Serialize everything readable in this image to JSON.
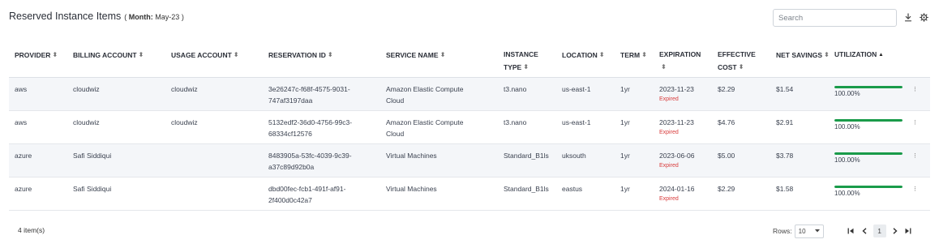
{
  "header": {
    "title": "Reserved Instance Items",
    "paren_open": "(",
    "month_label": "Month:",
    "month_value": "May-23",
    "paren_close": ")"
  },
  "search": {
    "placeholder": "Search",
    "value": ""
  },
  "toolbar": {
    "download_icon": "download-icon",
    "settings_icon": "gear-icon"
  },
  "table": {
    "columns": [
      {
        "line1": "PROVIDER",
        "line2": "",
        "sort": "both"
      },
      {
        "line1": "BILLING ACCOUNT",
        "line2": "",
        "sort": "both"
      },
      {
        "line1": "USAGE ACCOUNT",
        "line2": "",
        "sort": "both"
      },
      {
        "line1": "RESERVATION ID",
        "line2": "",
        "sort": "both"
      },
      {
        "line1": "SERVICE NAME",
        "line2": "",
        "sort": "both"
      },
      {
        "line1": "INSTANCE",
        "line2": "TYPE",
        "sort": "both"
      },
      {
        "line1": "LOCATION",
        "line2": "",
        "sort": "both"
      },
      {
        "line1": "TERM",
        "line2": "",
        "sort": "both"
      },
      {
        "line1": "EXPIRATION",
        "line2": "",
        "sort": "both"
      },
      {
        "line1": "EFFECTIVE",
        "line2": "COST",
        "sort": "both"
      },
      {
        "line1": "NET SAVINGS",
        "line2": "",
        "sort": "both"
      },
      {
        "line1": "UTILIZATION",
        "line2": "",
        "sort": "asc"
      }
    ],
    "rows": [
      {
        "provider": "aws",
        "billing_account": "cloudwiz",
        "usage_account": "cloudwiz",
        "reservation_id_1": "3e26247c-f68f-4575-9031-",
        "reservation_id_2": "747af3197daa",
        "service_1": "Amazon Elastic Compute",
        "service_2": "Cloud",
        "instance_type": "t3.nano",
        "location": "us-east-1",
        "term": "1yr",
        "expiration": "2023-11-23",
        "status": "Expired",
        "effective_cost": "$2.29",
        "net_savings": "$1.54",
        "utilization": "100.00%",
        "utilization_fraction": 1.0
      },
      {
        "provider": "aws",
        "billing_account": "cloudwiz",
        "usage_account": "cloudwiz",
        "reservation_id_1": "5132edf2-36d0-4756-99c3-",
        "reservation_id_2": "68334cf12576",
        "service_1": "Amazon Elastic Compute",
        "service_2": "Cloud",
        "instance_type": "t3.nano",
        "location": "us-east-1",
        "term": "1yr",
        "expiration": "2023-11-23",
        "status": "Expired",
        "effective_cost": "$4.76",
        "net_savings": "$2.91",
        "utilization": "100.00%",
        "utilization_fraction": 1.0
      },
      {
        "provider": "azure",
        "billing_account": "Safi Siddiqui",
        "usage_account": "",
        "reservation_id_1": "8483905a-53fc-4039-9c39-",
        "reservation_id_2": "a37c89d92b0a",
        "service_1": "Virtual Machines",
        "service_2": "",
        "instance_type": "Standard_B1ls",
        "location": "uksouth",
        "term": "1yr",
        "expiration": "2023-06-06",
        "status": "Expired",
        "effective_cost": "$5.00",
        "net_savings": "$3.78",
        "utilization": "100.00%",
        "utilization_fraction": 1.0
      },
      {
        "provider": "azure",
        "billing_account": "Safi Siddiqui",
        "usage_account": "",
        "reservation_id_1": "dbd00fec-fcb1-491f-af91-",
        "reservation_id_2": "2f400d0c42a7",
        "service_1": "Virtual Machines",
        "service_2": "",
        "instance_type": "Standard_B1ls",
        "location": "eastus",
        "term": "1yr",
        "expiration": "2024-01-16",
        "status": "Expired",
        "effective_cost": "$2.29",
        "net_savings": "$1.58",
        "utilization": "100.00%",
        "utilization_fraction": 1.0
      }
    ],
    "row_menu_glyph": "⁝"
  },
  "footer": {
    "item_count": "4 item(s)",
    "rows_label": "Rows:",
    "rows_value": "10",
    "current_page": "1"
  },
  "colors": {
    "utilization_fill": "#1a9b4a",
    "expired": "#d83b3b",
    "stripe": "#f4f6f9"
  }
}
